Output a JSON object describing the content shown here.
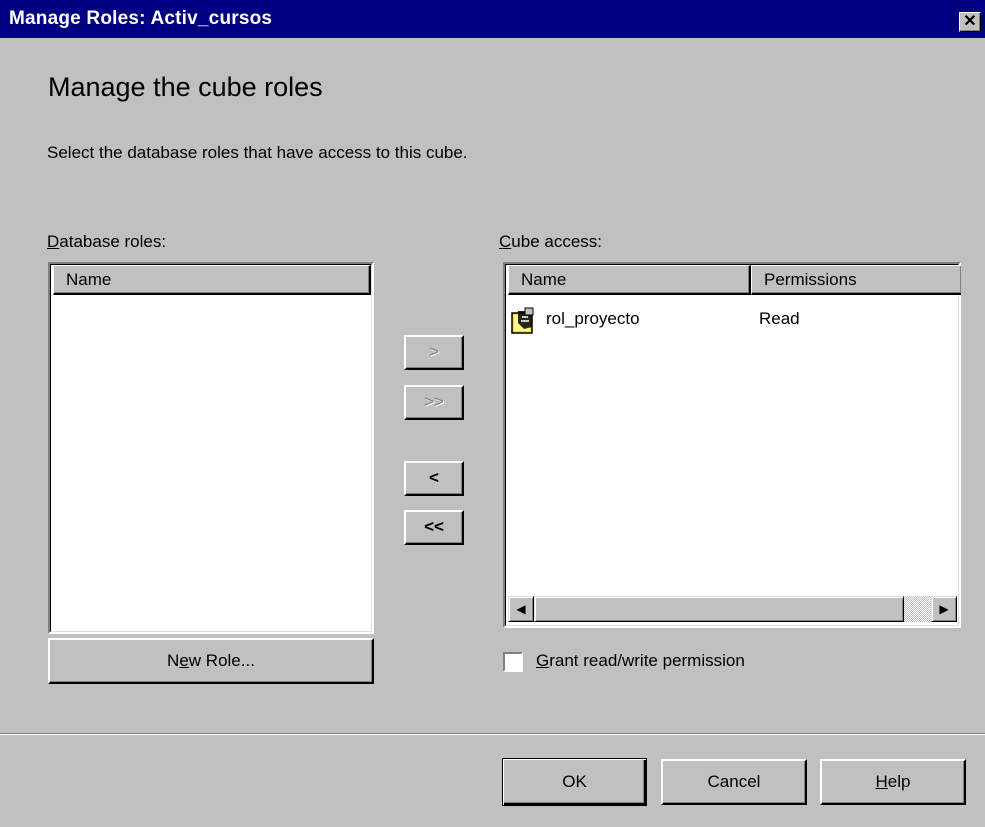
{
  "window": {
    "title": "Manage Roles: Activ_cursos",
    "close_glyph": "✕"
  },
  "page": {
    "heading": "Manage the cube roles",
    "instruction": "Select the database roles that have access to this cube."
  },
  "database_roles": {
    "label_accel": "D",
    "label_rest": "atabase roles:",
    "columns": [
      "Name"
    ],
    "rows": [],
    "new_role_accel_prefix": "N",
    "new_role_accel": "e",
    "new_role_rest": "w Role..."
  },
  "transfer_buttons": {
    "add": ">",
    "add_all": ">>",
    "remove": "<",
    "remove_all": "<<"
  },
  "cube_access": {
    "label_accel": "C",
    "label_rest": "ube access:",
    "columns": [
      "Name",
      "Permissions"
    ],
    "rows": [
      {
        "icon": "role-icon",
        "name": "rol_proyecto",
        "permissions": "Read"
      }
    ]
  },
  "grant_checkbox": {
    "label_accel": "G",
    "label_rest": "rant read/write permission",
    "checked": false
  },
  "footer": {
    "ok": "OK",
    "cancel": "Cancel",
    "help_accel": "H",
    "help_rest": "elp"
  },
  "colors": {
    "titlebar": "#000080",
    "face": "#c0c0c0",
    "role_icon": "#f0e020"
  }
}
